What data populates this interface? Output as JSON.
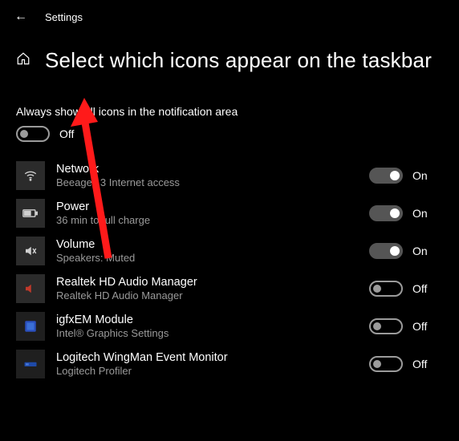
{
  "header": {
    "settings_label": "Settings"
  },
  "title": "Select which icons appear on the taskbar",
  "master": {
    "label": "Always show all icons in the notification area",
    "state_text": "Off",
    "on": false
  },
  "on_text": "On",
  "off_text": "Off",
  "items": [
    {
      "icon": "wifi",
      "title": "Network",
      "sub": "Beeagey 3 Internet access",
      "on": true
    },
    {
      "icon": "battery",
      "title": "Power",
      "sub": "36 min to full charge",
      "on": true
    },
    {
      "icon": "volume",
      "title": "Volume",
      "sub": "Speakers: Muted",
      "on": true
    },
    {
      "icon": "audio",
      "title": "Realtek HD Audio Manager",
      "sub": "Realtek HD Audio Manager",
      "on": false
    },
    {
      "icon": "gfx",
      "title": "igfxEM Module",
      "sub": "Intel® Graphics Settings",
      "on": false
    },
    {
      "icon": "logi",
      "title": "Logitech WingMan Event Monitor",
      "sub": "Logitech Profiler",
      "on": false
    }
  ]
}
